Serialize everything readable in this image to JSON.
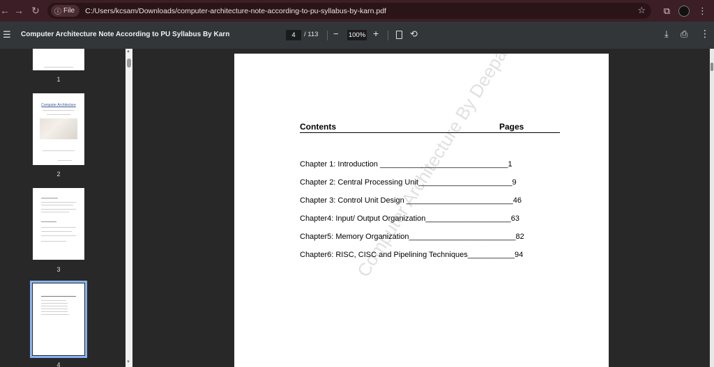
{
  "browser": {
    "file_chip": "File",
    "url": "C:/Users/kcsam/Downloads/computer-architecture-note-according-to-pu-syllabus-by-karn.pdf",
    "icons": [
      "back-icon",
      "forward-icon",
      "reload-icon",
      "info-icon",
      "star-icon",
      "extensions-icon",
      "avatar-icon",
      "more-icon"
    ]
  },
  "pdf_toolbar": {
    "title": "Computer Architecture Note According to PU Syllabus By Karn",
    "current_page": "4",
    "total_pages": "/ 113",
    "zoom": "100%"
  },
  "sidebar": {
    "thumbnails": [
      {
        "label": "1"
      },
      {
        "label": "2",
        "title": "Computer Architecture"
      },
      {
        "label": "3"
      },
      {
        "label": "4"
      }
    ]
  },
  "document": {
    "contents_label": "Contents",
    "pages_label": "Pages",
    "chapters": [
      {
        "text": "Chapter 1: Introduction ______________________________1"
      },
      {
        "text": "Chapter 2: Central Processing Unit______________________9"
      },
      {
        "text": "Chapter 3: Control Unit Design _________________________46"
      },
      {
        "text": "Chapter4: Input/ Output Organization____________________63"
      },
      {
        "text": "Chapter5: Memory Organization_________________________82"
      },
      {
        "text": "Chapter6: RISC, CISC and Pipelining Techniques___________94"
      }
    ],
    "watermark": "Computer Architecture By DeepakKr. Karn"
  }
}
